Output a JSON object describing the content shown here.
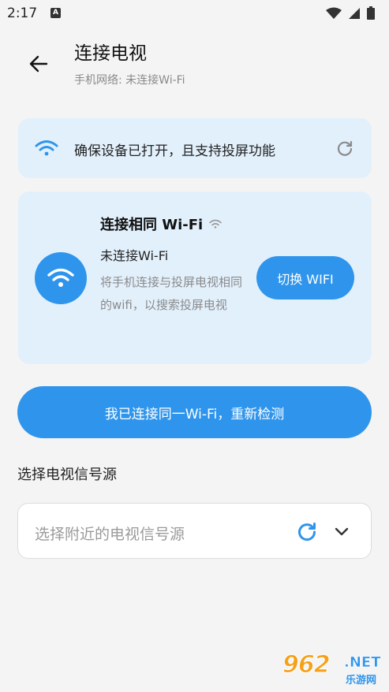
{
  "status_bar": {
    "time": "2:17",
    "notification_icon_letter": "A"
  },
  "header": {
    "title": "连接电视",
    "subtitle": "手机网络: 未连接Wi-Fi",
    "back_icon": "arrow-left-icon"
  },
  "notice": {
    "text": "确保设备已打开，且支持投屏功能",
    "icon": "wifi-icon",
    "refresh_icon": "refresh-icon"
  },
  "connect_card": {
    "title": "连接相同 Wi-Fi",
    "status": "未连接Wi-Fi",
    "hint": "将手机连接与投屏电视相同的wifi，以搜索投屏电视",
    "switch_button": "切换 WIFI"
  },
  "recheck_button": "我已连接同一Wi-Fi，重新检测",
  "source_section": {
    "label": "选择电视信号源",
    "placeholder": "选择附近的电视信号源"
  },
  "watermark": {
    "brand": "962",
    "domain": ".NET",
    "site": "乐游网"
  },
  "colors": {
    "accent": "#2f95ec",
    "card_bg": "#e2f0fc",
    "page_bg": "#f4f4f4",
    "watermark_orange": "#f6a11a"
  }
}
